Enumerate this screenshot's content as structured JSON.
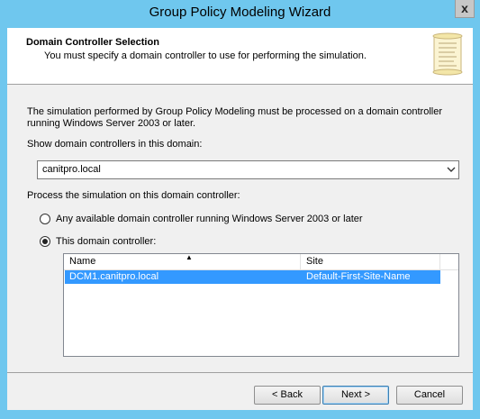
{
  "window": {
    "title": "Group Policy Modeling Wizard",
    "close_glyph": "x"
  },
  "header": {
    "title": "Domain Controller Selection",
    "subtitle": "You must specify a domain controller to use for performing the simulation.",
    "icon": "scroll-icon"
  },
  "body": {
    "intro": "The simulation performed by Group Policy Modeling must be processed on a domain controller running Windows Server 2003 or later.",
    "domain_label": "Show domain controllers in this domain:",
    "domain_value": "canitpro.local",
    "process_label": "Process the simulation on this domain controller:",
    "options": [
      {
        "label": "Any available domain controller running Windows Server 2003 or later",
        "checked": false
      },
      {
        "label": "This domain controller:",
        "checked": true
      }
    ]
  },
  "list": {
    "columns": [
      "Name",
      "Site"
    ],
    "sort_indicator": "▲",
    "rows": [
      {
        "name": "DCM1.canitpro.local",
        "site": "Default-First-Site-Name",
        "selected": true
      }
    ]
  },
  "buttons": {
    "back": "< Back",
    "next": "Next >",
    "cancel": "Cancel"
  },
  "colors": {
    "frame": "#6fc7ee",
    "selection": "#3399ff"
  }
}
